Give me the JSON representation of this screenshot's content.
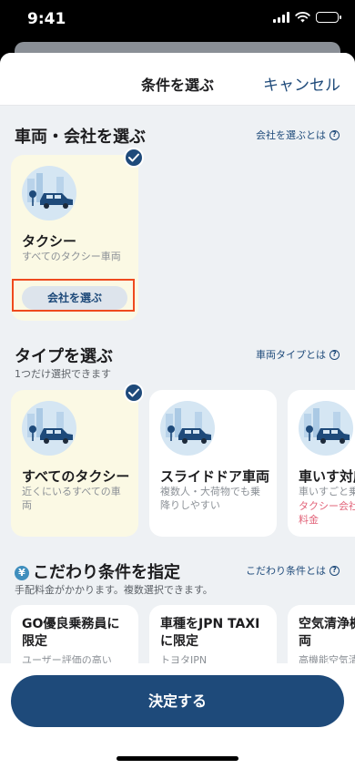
{
  "status_bar": {
    "time": "9:41"
  },
  "nav": {
    "title": "条件を選ぶ",
    "cancel": "キャンセル"
  },
  "sections": {
    "vehicle": {
      "title": "車両・会社を選ぶ",
      "link": "会社を選ぶとは"
    },
    "type": {
      "title": "タイプを選ぶ",
      "subtitle": "1つだけ選択できます",
      "link": "車両タイプとは"
    },
    "prefs": {
      "title": "こだわり条件を指定",
      "subtitle": "手配料金がかかります。複数選択できます。",
      "link": "こだわり条件とは"
    }
  },
  "vehicle_cards": [
    {
      "title": "タクシー",
      "desc": "すべてのタクシー車両",
      "button": "会社を選ぶ",
      "selected": true
    }
  ],
  "type_cards": [
    {
      "title": "すべてのタクシー",
      "desc": "近くにいるすべての車両",
      "selected": true
    },
    {
      "title": "スライドドア車両",
      "desc": "複数人・大荷物でも乗降りしやすい",
      "selected": false
    },
    {
      "title": "車いす対応",
      "desc": "車いすごと乗",
      "note": "タクシー会社車両指定料金",
      "selected": false
    }
  ],
  "pref_cards": [
    {
      "title": "GO優良乗務員に限定",
      "desc": "ユーザー評価の高い"
    },
    {
      "title": "車種をJPN TAXIに限定",
      "desc": "トヨタJPN"
    },
    {
      "title": "空気清浄機搭載車両",
      "desc": "高機能空気清"
    }
  ],
  "footer": {
    "submit": "決定する"
  },
  "colors": {
    "primary": "#1e4a7a",
    "selected_card_bg": "#fbf9e4",
    "highlight": "#ef4a1e",
    "note": "#e2647a"
  },
  "icons": [
    "signal-icon",
    "wifi-icon",
    "battery-icon",
    "check-icon",
    "question-icon",
    "yen-icon",
    "taxi-illustration"
  ]
}
